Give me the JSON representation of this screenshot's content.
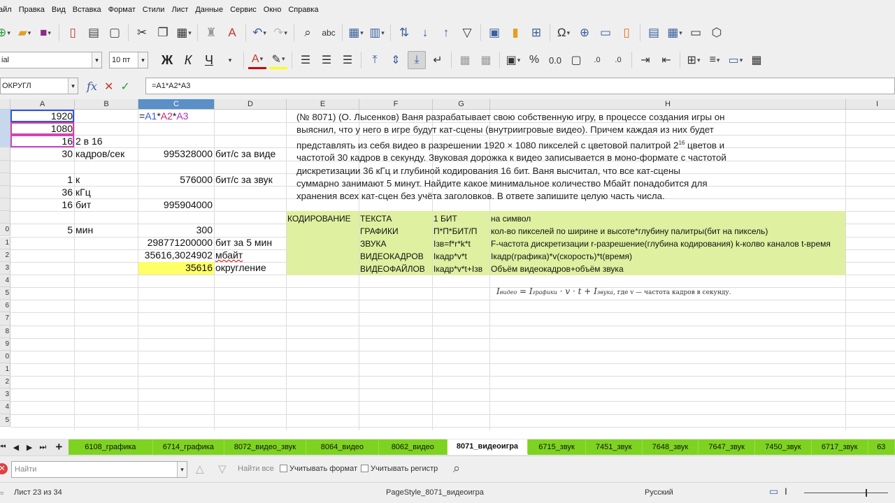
{
  "menu": [
    "айл",
    "Правка",
    "Вид",
    "Вставка",
    "Формат",
    "Стили",
    "Лист",
    "Данные",
    "Сервис",
    "Окно",
    "Справка"
  ],
  "toolbar2": {
    "font_name": "ial",
    "font_size": "10 пт",
    "bold": "Ж",
    "italic": "К",
    "underline": "Ч"
  },
  "formula_bar": {
    "name_box": "ОКРУГЛ",
    "formula": "=A1*A2*A3"
  },
  "columns": [
    "A",
    "B",
    "C",
    "D",
    "E",
    "F",
    "G",
    "H",
    "I"
  ],
  "rows": [
    "",
    "",
    "",
    "",
    "",
    "",
    "",
    "",
    "",
    "0",
    "1",
    "2",
    "3",
    "4",
    "5",
    "6",
    "7",
    "8",
    "9",
    "0",
    "1",
    "2",
    "3",
    "4",
    "5"
  ],
  "cells": {
    "a1": "1920",
    "a2": "1080",
    "a3": "16",
    "b3": "2 в 16",
    "a4": "30",
    "b4": "кадров/сек",
    "c4": "995328000",
    "d4": "бит/с за виде",
    "a6": "1",
    "b6": "к",
    "c6": "576000",
    "d6": "бит/с за звук",
    "a7": "36",
    "b7": "кГц",
    "a8": "16",
    "b8": "бит",
    "c8": "995904000",
    "a10": "5",
    "b10": "мин",
    "c10": "300",
    "c11": "298771200000",
    "d11": "бит за 5 мин",
    "c12": "35616,3024902",
    "d12": "мбайт",
    "c13": "35616",
    "d13": "округление"
  },
  "editing_formula": {
    "eq": "=",
    "a1": "A1",
    "m1": "*",
    "a2": "A2",
    "m2": "*",
    "a3": "A3"
  },
  "problem_text": {
    "line1": "(№ 8071)  (О. Лысенков) Ваня разрабатывает свою собственную игру, в процессе создания игры он",
    "line2": "выяснил, что у него в игре будут кат-сцены (внутриигровые видео). Причем каждая из них будет",
    "line3a": "представлять из себя видео в разрешении 1920 × 1080  пикселей с цветовой палитрой 2",
    "line3sup": "16",
    "line3b": " цветов и",
    "line4": "частотой 30  кадров в секунду. Звуковая дорожка к видео записывается в моно-формате с частотой",
    "line5": "дискретизации 36 кГц и глубиной кодирования 16 бит. Ваня высчитал, что все кат-сцены",
    "line6": "суммарно занимают 5 минут. Найдите какое минимальное количество Мбайт понадобится для",
    "line7": "хранения всех кат-сцен без учёта заголовков. В ответе запишите целую часть числа."
  },
  "encoding_table": {
    "e9": "КОДИРОВАНИЕ",
    "f": [
      "ТЕКСТА",
      "ГРАФИКИ",
      "ЗВУКА",
      "ВИДЕОКАДРОВ",
      "ВИДЕОФАЙЛОВ"
    ],
    "g": [
      "1 БИТ",
      "П*П*БИТ/П",
      "Iзв=f*r*k*t",
      "Iкадр*v*t",
      "Iкадр*v*t+Iзв"
    ],
    "h": [
      "на символ",
      "кол-во пикселей по ширине и высоте*глубину палитры(бит на пиксель)",
      "F-частота дискретизации r-разрешение(глубина кодирования) k-колво каналов t-время",
      "Iкадр(графика)*v(скорость)*t(время)",
      "Объём видеокадров+объём звука"
    ]
  },
  "formula_image": {
    "lhs": "I",
    "lhs_sub": "видео",
    "eq": " = ",
    "t1": "I",
    "t1_sub": "графики",
    "mid": " · v · t + ",
    "t2": "I",
    "t2_sub": "звука",
    "tail": ", где v — частота кадров в секунду."
  },
  "sheet_tabs": [
    "6108_графика",
    "6714_графика",
    "8072_видео_звук",
    "8064_видео",
    "8062_видео",
    "8071_видеоигра",
    "6715_звук",
    "7451_звук",
    "7648_звук",
    "7647_звук",
    "7450_звук",
    "6717_звук",
    "63"
  ],
  "active_tab": "8071_видеоигра",
  "findbar": {
    "placeholder": "Найти",
    "find_all": "Найти все",
    "match_format": "Учитывать формат",
    "match_case": "Учитывать регистр"
  },
  "status": {
    "sheet": "Лист 23 из 34",
    "page_style": "PageStyle_8071_видеоигра",
    "language": "Русский"
  },
  "colors": {
    "tab_green": "#7ed321",
    "table_fill": "#dff0a0",
    "highlight_yellow": "#ffff66",
    "selected_header": "#5a8fc8"
  }
}
